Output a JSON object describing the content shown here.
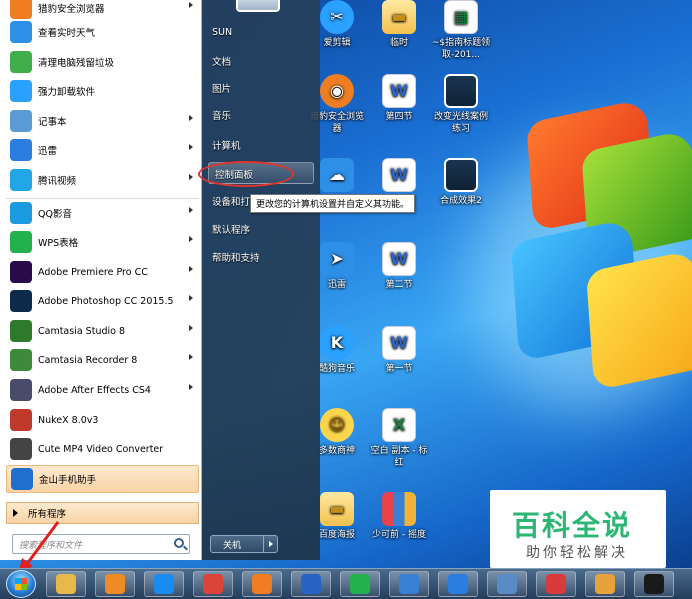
{
  "start_menu": {
    "programs": [
      {
        "label": "猎豹安全浏览器",
        "icon": "cheetah-browser-icon",
        "color": "#ef7d22",
        "arrow": true
      },
      {
        "label": "查看实时天气",
        "icon": "weather-icon",
        "color": "#2d8fe6",
        "arrow": false
      },
      {
        "label": "清理电脑残留垃圾",
        "icon": "recycle-icon",
        "color": "#3fae49",
        "arrow": false
      },
      {
        "label": "强力卸载软件",
        "icon": "uninstall-shield-icon",
        "color": "#2aa0ff",
        "arrow": false
      },
      {
        "label": "记事本",
        "icon": "notepad-icon",
        "color": "#5b9bd5",
        "arrow": true
      },
      {
        "label": "迅雷",
        "icon": "thunder-bird-icon",
        "color": "#2b7de0",
        "arrow": true
      },
      {
        "label": "腾讯视频",
        "icon": "tencent-video-icon",
        "color": "#23a6e8",
        "arrow": true
      },
      {
        "label": "QQ影音",
        "icon": "qq-player-icon",
        "color": "#1a9be0",
        "arrow": true
      },
      {
        "label": "WPS表格",
        "icon": "wps-sheet-icon",
        "color": "#23b14d",
        "arrow": true
      },
      {
        "label": "Adobe Premiere Pro CC",
        "icon": "premiere-icon",
        "color": "#2a0a4a",
        "arrow": true
      },
      {
        "label": "Adobe Photoshop CC 2015.5",
        "icon": "photoshop-icon",
        "color": "#0c2a4a",
        "arrow": true
      },
      {
        "label": "Camtasia Studio 8",
        "icon": "camtasia-icon",
        "color": "#2d7a2d",
        "arrow": true
      },
      {
        "label": "Camtasia Recorder 8",
        "icon": "camtasia-recorder-icon",
        "color": "#3d8a3d",
        "arrow": true
      },
      {
        "label": "Adobe After Effects CS4",
        "icon": "after-effects-icon",
        "color": "#4a4a6a",
        "arrow": true
      },
      {
        "label": "NukeX 8.0v3",
        "icon": "nukex-icon",
        "color": "#c0392b",
        "arrow": false
      },
      {
        "label": "Cute MP4 Video Converter",
        "icon": "video-converter-icon",
        "color": "#444444",
        "arrow": false
      },
      {
        "label": "金山手机助手",
        "icon": "phone-assistant-icon",
        "color": "#1f6fd1",
        "arrow": false
      }
    ],
    "all_programs": "所有程序",
    "search_placeholder": "搜索程序和文件",
    "right_items": [
      "SUN",
      "文档",
      "图片",
      "音乐",
      "计算机",
      "控制面板",
      "设备和打",
      "默认程序",
      "帮助和支持"
    ],
    "selected_right_item": "控制面板",
    "tooltip": "更改您的计算机设置并自定义其功能。",
    "shutdown_label": "关机"
  },
  "desktop_icons": [
    {
      "label": "爱剪辑",
      "icon": "aijianji-icon"
    },
    {
      "label": "猎豹安全浏览器",
      "icon": "cheetah-browser-icon"
    },
    {
      "label": "",
      "icon": "baidu-netdisk-icon"
    },
    {
      "label": "迅雷",
      "icon": "thunder-icon"
    },
    {
      "label": "酷狗音乐",
      "icon": "kugou-icon"
    },
    {
      "label": "多数商神",
      "icon": "face-icon"
    },
    {
      "label": "百度海报",
      "icon": "folder-icon"
    },
    {
      "label": "临时",
      "icon": "folder-icon"
    },
    {
      "label": "第四节",
      "icon": "word-doc-icon"
    },
    {
      "label": "",
      "icon": "word-doc-icon"
    },
    {
      "label": "第二节",
      "icon": "word-doc-icon"
    },
    {
      "label": "第一节",
      "icon": "word-doc-icon"
    },
    {
      "label": "空白 副本 - 标红",
      "icon": "excel-doc-icon"
    },
    {
      "label": "少可前 - 摇度",
      "icon": "zip-archive-icon"
    },
    {
      "label": "~$指南标题领取-201...",
      "icon": "excel-doc-icon"
    },
    {
      "label": "改变光线案例练习",
      "icon": "image-thumbnail-icon"
    },
    {
      "label": "合成效果2",
      "icon": "image-thumbnail-icon"
    }
  ],
  "watermark": {
    "title": "百科全说",
    "subtitle": "助你轻松解决",
    "color": "#2bb673"
  },
  "taskbar": {
    "buttons": [
      {
        "name": "explorer",
        "icon": "folder-icon",
        "color": "#e8b84a"
      },
      {
        "name": "media",
        "icon": "media-player-icon",
        "color": "#f08a24"
      },
      {
        "name": "kugou",
        "icon": "kugou-icon",
        "color": "#1a8cf0"
      },
      {
        "name": "chrome",
        "icon": "chrome-icon",
        "color": "#db4437"
      },
      {
        "name": "cheetah",
        "icon": "cheetah-browser-icon",
        "color": "#ef7d22"
      },
      {
        "name": "word",
        "icon": "word-icon",
        "color": "#2b63c5"
      },
      {
        "name": "wps",
        "icon": "wps-sheet-icon",
        "color": "#23b14d"
      },
      {
        "name": "aijianji",
        "icon": "aijianji-icon",
        "color": "#3a7fd6"
      },
      {
        "name": "wps-word",
        "icon": "wps-word-icon",
        "color": "#2b7de0"
      },
      {
        "name": "remote",
        "icon": "remote-desktop-icon",
        "color": "#5b8bc5"
      },
      {
        "name": "toolbox",
        "icon": "toolbox-icon",
        "color": "#d83b3b"
      },
      {
        "name": "briefcase",
        "icon": "briefcase-icon",
        "color": "#e8a23a"
      },
      {
        "name": "camtasia",
        "icon": "camtasia-icon",
        "color": "#1a1a1a"
      }
    ]
  }
}
